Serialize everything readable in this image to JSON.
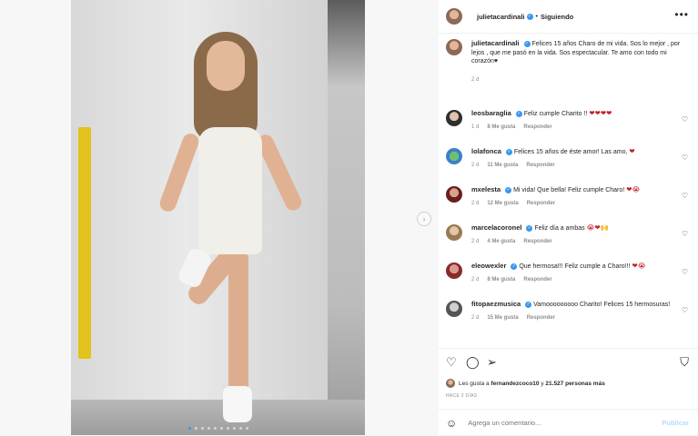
{
  "post": {
    "carousel_dots": 10,
    "active_dot": 0
  },
  "header": {
    "username": "julietacardinali",
    "separator": "•",
    "follow_status": "Siguiendo",
    "more": "•••"
  },
  "caption": {
    "username": "julietacardinali",
    "text": "Felices 15 años Charo de mi vida. Sos lo mejor , por lejos , que me pasó en la vida. Sos espectacular. Te amo con todo mi corazón♥",
    "age": "2 d"
  },
  "comments": [
    {
      "username": "leosbaraglia",
      "verified": true,
      "text": "Feliz cumple Charito !!",
      "emoji": "❤❤❤❤",
      "age": "1 d",
      "likes": "8 Me gusta",
      "reply": "Responder"
    },
    {
      "username": "lolafonca",
      "verified": true,
      "text": "Felices 15 años de éste amor! Las amo,",
      "emoji": "❤",
      "age": "2 d",
      "likes": "11 Me gusta",
      "reply": "Responder"
    },
    {
      "username": "mxelesta",
      "verified": true,
      "text": "Mi vida! Que bella! Feliz cumple Charo!",
      "emoji": "❤😭",
      "age": "2 d",
      "likes": "12 Me gusta",
      "reply": "Responder"
    },
    {
      "username": "marcelacoronel",
      "verified": true,
      "text": "Feliz día a ambas",
      "emoji": "😭❤🙌",
      "age": "2 d",
      "likes": "4 Me gusta",
      "reply": "Responder"
    },
    {
      "username": "eleowexler",
      "verified": true,
      "text": "Que hermosa!!! Feliz cumple a Charo!!!",
      "emoji": "❤😭",
      "age": "2 d",
      "likes": "8 Me gusta",
      "reply": "Responder"
    },
    {
      "username": "fitopaezmusica",
      "verified": true,
      "text": "Vamooooooooo Charito! Felices 15 hermosuras!",
      "emoji": "",
      "age": "2 d",
      "likes": "15 Me gusta",
      "reply": "Responder"
    }
  ],
  "actions": {
    "like_icon": "heart-outline-icon",
    "comment_icon": "comment-bubble-icon",
    "share_icon": "paper-plane-icon",
    "save_icon": "bookmark-icon"
  },
  "likes": {
    "prefix": "Les gusta a",
    "user": "fernandezcoco10",
    "conjunction": "y",
    "others": "21.527 personas más"
  },
  "timeago": "HACE 2 DÍAS",
  "add_comment": {
    "placeholder": "Agrega un comentario...",
    "publish": "Publicar"
  }
}
